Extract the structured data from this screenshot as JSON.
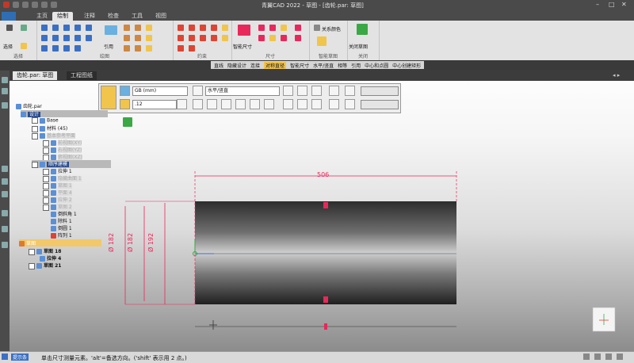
{
  "window": {
    "title": "青翼CAD 2022 - 草图 - [齿轮.par: 草图]"
  },
  "menu_tabs": [
    "主页",
    "绘制",
    "注释",
    "检查",
    "工具",
    "视图"
  ],
  "active_tab": "绘制",
  "ribbon": {
    "groups": [
      "选择",
      "绘图",
      "约束",
      "尺寸",
      "智能草图",
      "关闭"
    ],
    "select_label": "选择",
    "ref_label": "引用",
    "smart_dim_label": "智能尺寸",
    "relations_label": "关系颜色",
    "close_sketch_label": "关闭草图"
  },
  "command_bar": [
    "直线",
    "隐藏设计",
    "连接",
    "对称直径",
    "智能尺寸",
    "水平/竖直",
    "相等",
    "引用",
    "中心和点圆",
    "中心创建矩形"
  ],
  "command_bar_active": "对称直径",
  "doc_tabs": [
    "齿轮.par: 草图",
    "工程图纸"
  ],
  "sketch_toolbar": {
    "standard": "GB (mm)",
    "precision": ".12",
    "orientation": "水平/竖直"
  },
  "tree": {
    "root": "齿轮.par",
    "design": "设计",
    "base": "Base",
    "material": "材料 (45)",
    "ref_planes": "基本参考平面",
    "plane_xy": "前视图(XY)",
    "plane_yz": "右视图(YZ)",
    "plane_xz": "俯视图(XZ)",
    "sequence": "顺序建模",
    "items": [
      "拉伸 1",
      "隐藏曲面 1",
      "草图 1",
      "平面 4",
      "拉伸 2",
      "草图 2",
      "倒斜角 1",
      "除料 1",
      "倒圆 1",
      "阵列 1"
    ],
    "sketch_group": "草图",
    "sketch_items": [
      "草图 18",
      "拉伸 4",
      "草图 21"
    ]
  },
  "dimensions": {
    "length": "506",
    "d1": "Ø 182",
    "d2": "Ø 182",
    "d3": "Ø 192"
  },
  "status": {
    "label": "提示条",
    "message": "单击尺寸测量元素。'alt'=备选方向。('shift' 表示用 2 点。)"
  },
  "colors": {
    "dimension": "#e8285a",
    "accent": "#f1c44c",
    "ribbon": "#e3e3e3"
  }
}
